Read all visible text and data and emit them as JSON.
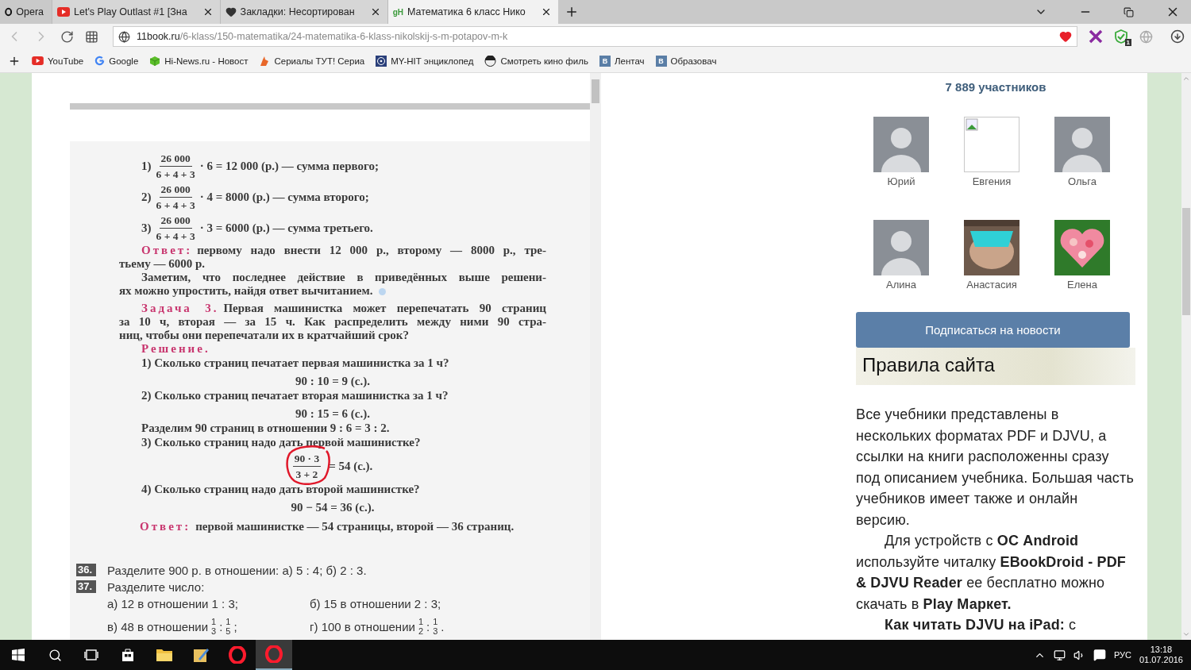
{
  "browser": {
    "menu_label": "Opera",
    "tabs": [
      {
        "title": "Let's Play Outlast #1 [Зна",
        "selected": false
      },
      {
        "title": "Закладки: Несортирован",
        "selected": false
      },
      {
        "title": "Математика 6 класс Нико",
        "icon_text": "gH",
        "selected": true
      }
    ],
    "address": {
      "domain": "11book.ru",
      "path": "/6-klass/150-matematika/24-matematika-6-klass-nikolskij-s-m-potapov-m-k"
    },
    "extension_badge": "1",
    "bookmarks": [
      {
        "label": "YouTube"
      },
      {
        "label": "Google"
      },
      {
        "label": "Hi-News.ru - Новост"
      },
      {
        "label": "Сериалы ТУТ! Сериа"
      },
      {
        "label": "MY-HIT энциклопед"
      },
      {
        "label": "Смотреть кино филь"
      },
      {
        "label": "Лентач",
        "icon_text": "В"
      },
      {
        "label": "Образовач",
        "icon_text": "В"
      }
    ]
  },
  "book": {
    "lines": [
      {
        "kind": "fraction_step",
        "number": "1)",
        "numerator": "26 000",
        "denominator": "6 + 4 + 3",
        "text": "· 6 = 12 000 (р.) — сумма первого;"
      },
      {
        "kind": "fraction_step",
        "number": "2)",
        "numerator": "26 000",
        "denominator": "6 + 4 + 3",
        "text": "· 4 = 8000 (р.) — сумма второго;"
      },
      {
        "kind": "fraction_step",
        "number": "3)",
        "numerator": "26 000",
        "denominator": "6 + 4 + 3",
        "text": "· 3 = 6000 (р.) — сумма третьего."
      },
      {
        "kind": "labeled",
        "label": "Ответ:",
        "text": "первому надо внести 12 000 р., второму — 8000 р., тре-"
      },
      {
        "kind": "last",
        "text": "тьему — 6000 р."
      },
      {
        "kind": "indent",
        "text": "Заметим, что последнее действие в приведённых выше решени-"
      },
      {
        "kind": "last",
        "text": "ях можно упростить, найдя ответ вычитанием.",
        "dot": true
      },
      {
        "kind": "task",
        "label": "Задача 3.",
        "text": "Первая машинистка может перепечатать 90 страниц"
      },
      {
        "kind": "line",
        "text": "за 10 ч, вторая — за 15 ч. Как распределить между ними 90 стра-"
      },
      {
        "kind": "last",
        "text": "ниц, чтобы они перепечатали их в кратчайший срок?"
      },
      {
        "kind": "heading",
        "text": "Решение."
      },
      {
        "kind": "question",
        "text": "1) Сколько страниц печатает первая машинистка за 1 ч?"
      },
      {
        "kind": "formula",
        "text": "90 : 10 = 9 (с.)."
      },
      {
        "kind": "question",
        "text": "2) Сколько страниц печатает вторая машинистка за 1 ч?"
      },
      {
        "kind": "formula",
        "text": "90 : 15 = 6 (с.)."
      },
      {
        "kind": "question",
        "text": "Разделим 90 страниц в отношении 9 : 6 = 3 : 2."
      },
      {
        "kind": "question",
        "text": "3) Сколько страниц надо дать первой машинистке?"
      },
      {
        "kind": "circled_fraction",
        "numerator": "90 · 3",
        "denominator": "3 + 2",
        "text": "= 54 (с.)."
      },
      {
        "kind": "question",
        "text": "4) Сколько страниц надо дать второй машинистке?"
      },
      {
        "kind": "formula",
        "text": "90 − 54 = 36 (с.)."
      },
      {
        "kind": "answer",
        "label": "Ответ:",
        "text": "первой машинистке — 54 страницы, второй — 36 страниц."
      }
    ],
    "exercises": [
      {
        "number": "36.",
        "text": "Разделите 900 р. в отношении: а) 5 : 4; б) 2 : 3."
      },
      {
        "number": "37.",
        "text": "Разделите число:",
        "items": [
          {
            "text": "а) 12 в отношении 1 : 3;"
          },
          {
            "text": "б) 15 в отношении 2 : 3;"
          },
          {
            "text": "в) 48 в отношении",
            "ratio": [
              {
                "num": "1",
                "den": "3"
              },
              {
                "num": "1",
                "den": "5"
              }
            ],
            "separator": ":",
            "end": ";"
          },
          {
            "text": "г) 100 в отношении",
            "ratio": [
              {
                "num": "1",
                "den": "2"
              },
              {
                "num": "1",
                "den": "3"
              }
            ],
            "separator": ":",
            "end": "."
          }
        ]
      }
    ]
  },
  "sidebar": {
    "members_count": "7 889 участников",
    "members": [
      {
        "name": "Юрий",
        "kind": "person"
      },
      {
        "name": "Евгения",
        "kind": "broken"
      },
      {
        "name": "Ольга",
        "kind": "person"
      },
      {
        "name": "Алина",
        "kind": "person"
      },
      {
        "name": "Анастасия",
        "kind": "picture"
      },
      {
        "name": "Елена",
        "kind": "heart"
      }
    ],
    "subscribe_button": "Подписаться на новости",
    "rules_title": "Правила сайта",
    "paragraphs": [
      {
        "text": "Все учебники представлены в нескольких форматах PDF и DJVU, а ссылки на книги расположенны сразу под описанием учебника. Большая часть учебников имеет также и онлайн версию.",
        "indent": false
      },
      {
        "text": "Для устройств с **ОС Android** используйте читалку **EBookDroid - PDF & DJVU Reader** ее бесплатно можно скачать в **Play Маркет.**",
        "indent": true
      },
      {
        "text": "**Как читать DJVU на iPad:** с",
        "indent": true
      }
    ]
  },
  "taskbar": {
    "apps": [
      {
        "kind": "store",
        "active": false
      },
      {
        "kind": "explorer",
        "active": false
      },
      {
        "kind": "paint",
        "active": false
      },
      {
        "kind": "opera",
        "active": false
      },
      {
        "kind": "opera",
        "active": true
      }
    ],
    "language": "РУС",
    "time": "13:18",
    "date": "01.07.2016"
  }
}
